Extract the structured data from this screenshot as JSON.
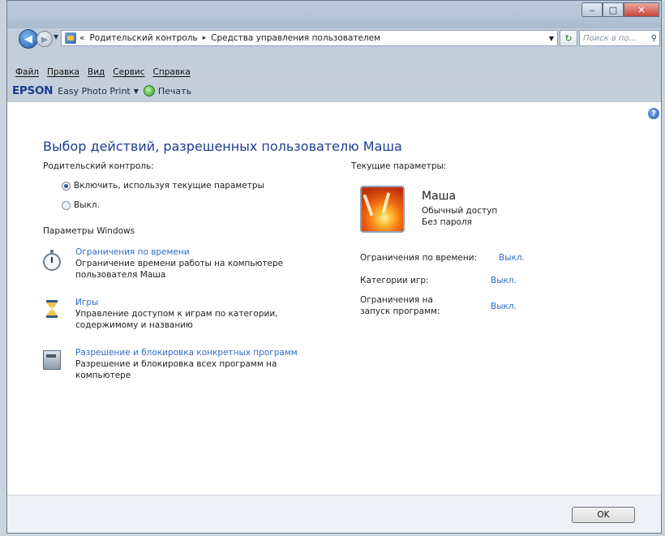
{
  "window": {
    "caption": {
      "minimize": "‒",
      "maximize": "□",
      "close": "✕"
    }
  },
  "nav": {
    "back_glyph": "◀",
    "forward_glyph": "▶",
    "breadcrumb_prefix": "«",
    "breadcrumb": [
      "Родительский контроль",
      "Средства управления пользователем"
    ],
    "breadcrumb_sep": "▸",
    "search_placeholder": "Поиск в по..."
  },
  "menu": [
    "Файл",
    "Правка",
    "Вид",
    "Сервис",
    "Справка"
  ],
  "toolbar": {
    "brand": "EPSON",
    "app": "Easy Photo Print",
    "print": "Печать"
  },
  "main": {
    "title": "Выбор действий, разрешенных пользователю Маша",
    "parental_label": "Родительский контроль:",
    "options": [
      {
        "label": "Включить, используя текущие параметры",
        "selected": true
      },
      {
        "label": "Выкл.",
        "selected": false
      }
    ],
    "windows_params_label": "Параметры Windows",
    "items": [
      {
        "icon": "stopwatch-icon",
        "link": "Ограничения по времени",
        "desc1": "Ограничение времени работы на компьютере",
        "desc2": "пользователя Маша"
      },
      {
        "icon": "hourglass-icon",
        "link": "Игры",
        "desc1": "Управление доступом к играм по категории,",
        "desc2": "содержимому и названию"
      },
      {
        "icon": "program-block-icon",
        "link": "Разрешение и блокировка конкретных программ",
        "desc1": "Разрешение и блокировка всех программ на",
        "desc2": "компьютере"
      }
    ]
  },
  "current": {
    "label": "Текущие параметры:",
    "user": {
      "name": "Маша",
      "type": "Обычный доступ",
      "password": "Без пароля"
    },
    "settings": [
      {
        "name": "Ограничения по времени:",
        "value": "Выкл."
      },
      {
        "name": "Категории игр:",
        "value": "Выкл."
      },
      {
        "name": "Ограничения на",
        "name2": "запуск программ:",
        "value": "Выкл."
      }
    ]
  },
  "footer": {
    "ok": "OK"
  },
  "colors": {
    "link": "#2e6cc7",
    "title": "#1e3d8f",
    "chrome": "#c0ccd9"
  }
}
